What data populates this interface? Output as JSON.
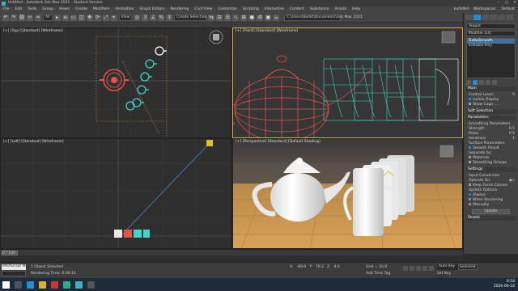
{
  "window": {
    "title": "Untitled - Autodesk 3ds Max 2021 - Student Version",
    "controls": [
      "—",
      "□",
      "✕"
    ]
  },
  "menu": {
    "items": [
      "File",
      "Edit",
      "Tools",
      "Group",
      "Views",
      "Create",
      "Modifiers",
      "Animation",
      "Graph Editors",
      "Rendering",
      "Civil View",
      "Customize",
      "Scripting",
      "Interactive",
      "Content",
      "Substance",
      "Arnold",
      "Help"
    ],
    "user": "bulletbd",
    "workspaces_label": "Workspaces:",
    "workspace_value": "Default"
  },
  "toolbar": {
    "filter_value": "All",
    "selection_set_placeholder": "Create Selection Se",
    "view_value": "View",
    "path": "C:\\Users\\bullet\\Documents\\3ds Max 2021"
  },
  "viewports": {
    "top": "[+] [Top] [Standard] [Wireframe]",
    "front": "[+] [Front] [Standard] [Wireframe]",
    "left": "[+] [Left] [Standard] [Wireframe]",
    "perspective": "[+] [Perspective] [Standard] [Default Shading]"
  },
  "command_panel": {
    "object_name": "Teapot",
    "modifier_list": "Modifier List",
    "stack": [
      "TurboSmooth",
      "Editable Poly"
    ],
    "params": {
      "main_label": "Main",
      "control_level_label": "Control Level:",
      "control_level": "0",
      "isoline_display": "Isoline Display",
      "show_cage": "Show Cage......",
      "soft_selection": "Soft Selection",
      "parameters": "Parameters",
      "smoothing_params": "Smoothing Parameters",
      "strength_label": "Strength",
      "strength": "0.5",
      "relax_label": "Relax",
      "relax": "0.5",
      "iterations_label": "Iterations",
      "iterations": "1",
      "surface_params": "Surface Parameters",
      "smooth_result": "Smooth Result",
      "separate_by": "Separate by:",
      "materials": "Materials",
      "smoothing_groups": "Smoothing Groups",
      "settings": "Settings",
      "input_conversion": "Input Conversion",
      "operate_on": "Operate On:",
      "keep_faces_convex": "Keep Faces Convex",
      "update_options": "Update Options",
      "always": "Always",
      "when_rendering": "When Rendering",
      "manually": "Manually",
      "update_btn": "Update",
      "resets": "Resets"
    }
  },
  "timeline": {
    "frame_label": "0 / 100",
    "ticks": [
      "0",
      "10",
      "20",
      "30",
      "40",
      "50",
      "60",
      "70",
      "80",
      "90",
      "100"
    ]
  },
  "status": {
    "maxscript": "MAXScript Mi",
    "objects_selected": "1 Object Selected",
    "rendering_time": "Rendering Time: 0:00:14",
    "x_label": "X:",
    "x": "-89.0",
    "y_label": "Y:",
    "y": "70.2",
    "z_label": "Z:",
    "z": "0.0",
    "grid": "Grid = 10.0",
    "add_time_tag": "Add Time Tag",
    "auto_key": "Auto Key",
    "selected": "Selected",
    "set_key": "Set Key",
    "key_filters": "Key Filters...",
    "frame_value": "0"
  },
  "taskbar": {
    "time": "0:18",
    "date": "2020-06-24"
  },
  "colors": {
    "accent": "#1e8fd6",
    "teapot_red": "#e8524a",
    "cup_cyan": "#42d6c8",
    "viewport_active": "#e0b02a"
  }
}
